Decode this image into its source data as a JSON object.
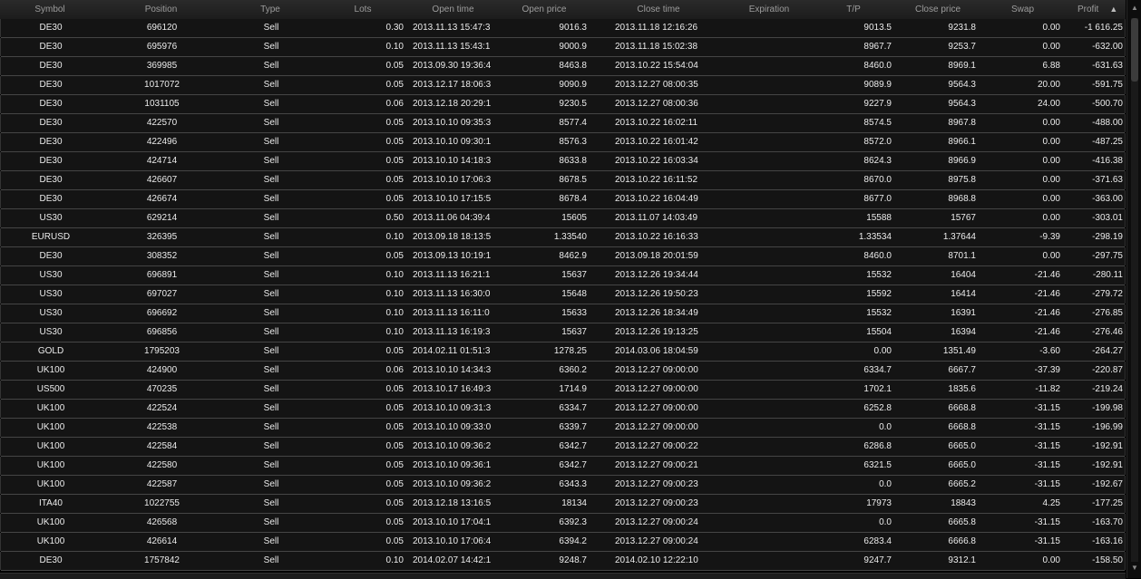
{
  "columns": {
    "symbol": "Symbol",
    "position": "Position",
    "type": "Type",
    "lots": "Lots",
    "open_time": "Open time",
    "open_price": "Open price",
    "close_time": "Close time",
    "expiration": "Expiration",
    "tp": "T/P",
    "close_price": "Close price",
    "swap": "Swap",
    "profit": "Profit",
    "sort_icon": "▲"
  },
  "rows": [
    [
      "DE30",
      "696120",
      "Sell",
      "0.30",
      "2013.11.13 15:47:3",
      "9016.3",
      "2013.11.18 12:16:26",
      "",
      "9013.5",
      "9231.8",
      "0.00",
      "-1 616.25"
    ],
    [
      "DE30",
      "695976",
      "Sell",
      "0.10",
      "2013.11.13 15:43:1",
      "9000.9",
      "2013.11.18 15:02:38",
      "",
      "8967.7",
      "9253.7",
      "0.00",
      "-632.00"
    ],
    [
      "DE30",
      "369985",
      "Sell",
      "0.05",
      "2013.09.30 19:36:4",
      "8463.8",
      "2013.10.22 15:54:04",
      "",
      "8460.0",
      "8969.1",
      "6.88",
      "-631.63"
    ],
    [
      "DE30",
      "1017072",
      "Sell",
      "0.05",
      "2013.12.17 18:06:3",
      "9090.9",
      "2013.12.27 08:00:35",
      "",
      "9089.9",
      "9564.3",
      "20.00",
      "-591.75"
    ],
    [
      "DE30",
      "1031105",
      "Sell",
      "0.06",
      "2013.12.18 20:29:1",
      "9230.5",
      "2013.12.27 08:00:36",
      "",
      "9227.9",
      "9564.3",
      "24.00",
      "-500.70"
    ],
    [
      "DE30",
      "422570",
      "Sell",
      "0.05",
      "2013.10.10 09:35:3",
      "8577.4",
      "2013.10.22 16:02:11",
      "",
      "8574.5",
      "8967.8",
      "0.00",
      "-488.00"
    ],
    [
      "DE30",
      "422496",
      "Sell",
      "0.05",
      "2013.10.10 09:30:1",
      "8576.3",
      "2013.10.22 16:01:42",
      "",
      "8572.0",
      "8966.1",
      "0.00",
      "-487.25"
    ],
    [
      "DE30",
      "424714",
      "Sell",
      "0.05",
      "2013.10.10 14:18:3",
      "8633.8",
      "2013.10.22 16:03:34",
      "",
      "8624.3",
      "8966.9",
      "0.00",
      "-416.38"
    ],
    [
      "DE30",
      "426607",
      "Sell",
      "0.05",
      "2013.10.10 17:06:3",
      "8678.5",
      "2013.10.22 16:11:52",
      "",
      "8670.0",
      "8975.8",
      "0.00",
      "-371.63"
    ],
    [
      "DE30",
      "426674",
      "Sell",
      "0.05",
      "2013.10.10 17:15:5",
      "8678.4",
      "2013.10.22 16:04:49",
      "",
      "8677.0",
      "8968.8",
      "0.00",
      "-363.00"
    ],
    [
      "US30",
      "629214",
      "Sell",
      "0.50",
      "2013.11.06 04:39:4",
      "15605",
      "2013.11.07 14:03:49",
      "",
      "15588",
      "15767",
      "0.00",
      "-303.01"
    ],
    [
      "EURUSD",
      "326395",
      "Sell",
      "0.10",
      "2013.09.18 18:13:5",
      "1.33540",
      "2013.10.22 16:16:33",
      "",
      "1.33534",
      "1.37644",
      "-9.39",
      "-298.19"
    ],
    [
      "DE30",
      "308352",
      "Sell",
      "0.05",
      "2013.09.13 10:19:1",
      "8462.9",
      "2013.09.18 20:01:59",
      "",
      "8460.0",
      "8701.1",
      "0.00",
      "-297.75"
    ],
    [
      "US30",
      "696891",
      "Sell",
      "0.10",
      "2013.11.13 16:21:1",
      "15637",
      "2013.12.26 19:34:44",
      "",
      "15532",
      "16404",
      "-21.46",
      "-280.11"
    ],
    [
      "US30",
      "697027",
      "Sell",
      "0.10",
      "2013.11.13 16:30:0",
      "15648",
      "2013.12.26 19:50:23",
      "",
      "15592",
      "16414",
      "-21.46",
      "-279.72"
    ],
    [
      "US30",
      "696692",
      "Sell",
      "0.10",
      "2013.11.13 16:11:0",
      "15633",
      "2013.12.26 18:34:49",
      "",
      "15532",
      "16391",
      "-21.46",
      "-276.85"
    ],
    [
      "US30",
      "696856",
      "Sell",
      "0.10",
      "2013.11.13 16:19:3",
      "15637",
      "2013.12.26 19:13:25",
      "",
      "15504",
      "16394",
      "-21.46",
      "-276.46"
    ],
    [
      "GOLD",
      "1795203",
      "Sell",
      "0.05",
      "2014.02.11 01:51:3",
      "1278.25",
      "2014.03.06 18:04:59",
      "",
      "0.00",
      "1351.49",
      "-3.60",
      "-264.27"
    ],
    [
      "UK100",
      "424900",
      "Sell",
      "0.06",
      "2013.10.10 14:34:3",
      "6360.2",
      "2013.12.27 09:00:00",
      "",
      "6334.7",
      "6667.7",
      "-37.39",
      "-220.87"
    ],
    [
      "US500",
      "470235",
      "Sell",
      "0.05",
      "2013.10.17 16:49:3",
      "1714.9",
      "2013.12.27 09:00:00",
      "",
      "1702.1",
      "1835.6",
      "-11.82",
      "-219.24"
    ],
    [
      "UK100",
      "422524",
      "Sell",
      "0.05",
      "2013.10.10 09:31:3",
      "6334.7",
      "2013.12.27 09:00:00",
      "",
      "6252.8",
      "6668.8",
      "-31.15",
      "-199.98"
    ],
    [
      "UK100",
      "422538",
      "Sell",
      "0.05",
      "2013.10.10 09:33:0",
      "6339.7",
      "2013.12.27 09:00:00",
      "",
      "0.0",
      "6668.8",
      "-31.15",
      "-196.99"
    ],
    [
      "UK100",
      "422584",
      "Sell",
      "0.05",
      "2013.10.10 09:36:2",
      "6342.7",
      "2013.12.27 09:00:22",
      "",
      "6286.8",
      "6665.0",
      "-31.15",
      "-192.91"
    ],
    [
      "UK100",
      "422580",
      "Sell",
      "0.05",
      "2013.10.10 09:36:1",
      "6342.7",
      "2013.12.27 09:00:21",
      "",
      "6321.5",
      "6665.0",
      "-31.15",
      "-192.91"
    ],
    [
      "UK100",
      "422587",
      "Sell",
      "0.05",
      "2013.10.10 09:36:2",
      "6343.3",
      "2013.12.27 09:00:23",
      "",
      "0.0",
      "6665.2",
      "-31.15",
      "-192.67"
    ],
    [
      "ITA40",
      "1022755",
      "Sell",
      "0.05",
      "2013.12.18 13:16:5",
      "18134",
      "2013.12.27 09:00:23",
      "",
      "17973",
      "18843",
      "4.25",
      "-177.25"
    ],
    [
      "UK100",
      "426568",
      "Sell",
      "0.05",
      "2013.10.10 17:04:1",
      "6392.3",
      "2013.12.27 09:00:24",
      "",
      "0.0",
      "6665.8",
      "-31.15",
      "-163.70"
    ],
    [
      "UK100",
      "426614",
      "Sell",
      "0.05",
      "2013.10.10 17:06:4",
      "6394.2",
      "2013.12.27 09:00:24",
      "",
      "6283.4",
      "6666.8",
      "-31.15",
      "-163.16"
    ],
    [
      "DE30",
      "1757842",
      "Sell",
      "0.10",
      "2014.02.07 14:42:1",
      "9248.7",
      "2014.02.10 12:22:10",
      "",
      "9247.7",
      "9312.1",
      "0.00",
      "-158.50"
    ]
  ],
  "scrollbar": {
    "up_icon": "▲",
    "down_icon": "▼"
  }
}
